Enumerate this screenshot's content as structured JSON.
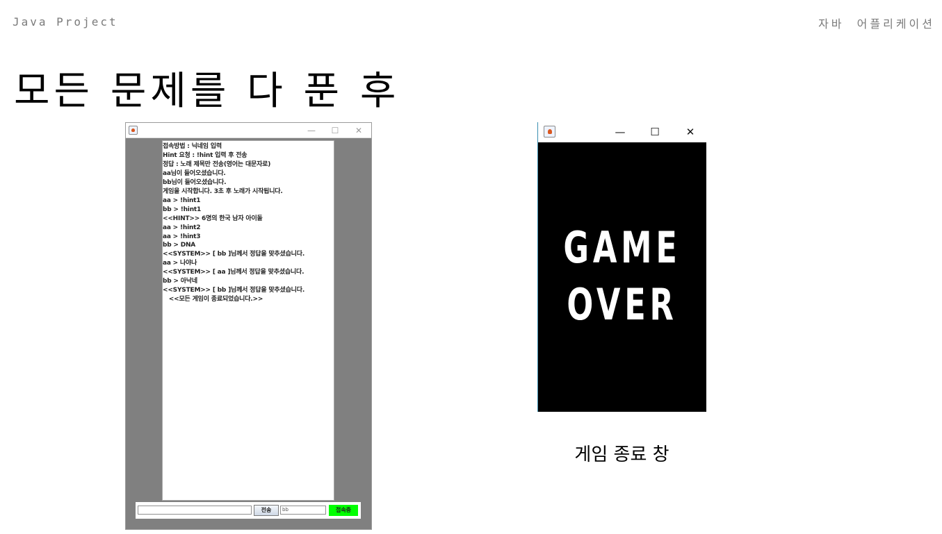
{
  "header": {
    "left": "Java Project",
    "right": "자바  어플리케이션"
  },
  "slide": {
    "title": "모든 문제를 다 푼 후",
    "caption": "게임 종료 창"
  },
  "chat_window": {
    "controls": {
      "minimize": "—",
      "maximize": "☐",
      "close": "✕"
    },
    "lines": [
      "접속방법 : 닉네임 입력",
      "Hint 요청 : !hint 입력 후 전송",
      "정답 : 노래 제목만 전송(영어는 대문자로)",
      "aa님이 들어오셨습니다.",
      "bb님이 들어오셨습니다.",
      "게임을 시작합니다. 3초 후 노래가 시작됩니다.",
      "aa > !hint1",
      "bb > !hint1",
      "<<HINT>> 6명의 한국 남자 아이돌",
      "aa > !hint2",
      "aa > !hint3",
      "bb > DNA",
      "<<SYSTEM>> [ bb ]님께서 정답을 맞추셨습니다.",
      "aa > 나야나",
      "<<SYSTEM>> [ aa ]님께서 정답을 맞추셨습니다.",
      "bb > 아낙네",
      "<<SYSTEM>> [ bb ]님께서 정답을 맞추셨습니다.",
      "   <<모든 게임이 종료되었습니다.>>"
    ],
    "message_input": {
      "value": ""
    },
    "send_label": "전송",
    "nickname_input": {
      "value": "bb"
    },
    "connect_label": "접속중",
    "colors": {
      "panel": "#808080",
      "connect_button": "#00ff00"
    }
  },
  "game_window": {
    "controls": {
      "minimize": "—",
      "maximize": "☐",
      "close": "✕"
    },
    "text_line1": "GAME",
    "text_line2": "OVER",
    "colors": {
      "background": "#000000",
      "text": "#ffffff"
    }
  }
}
